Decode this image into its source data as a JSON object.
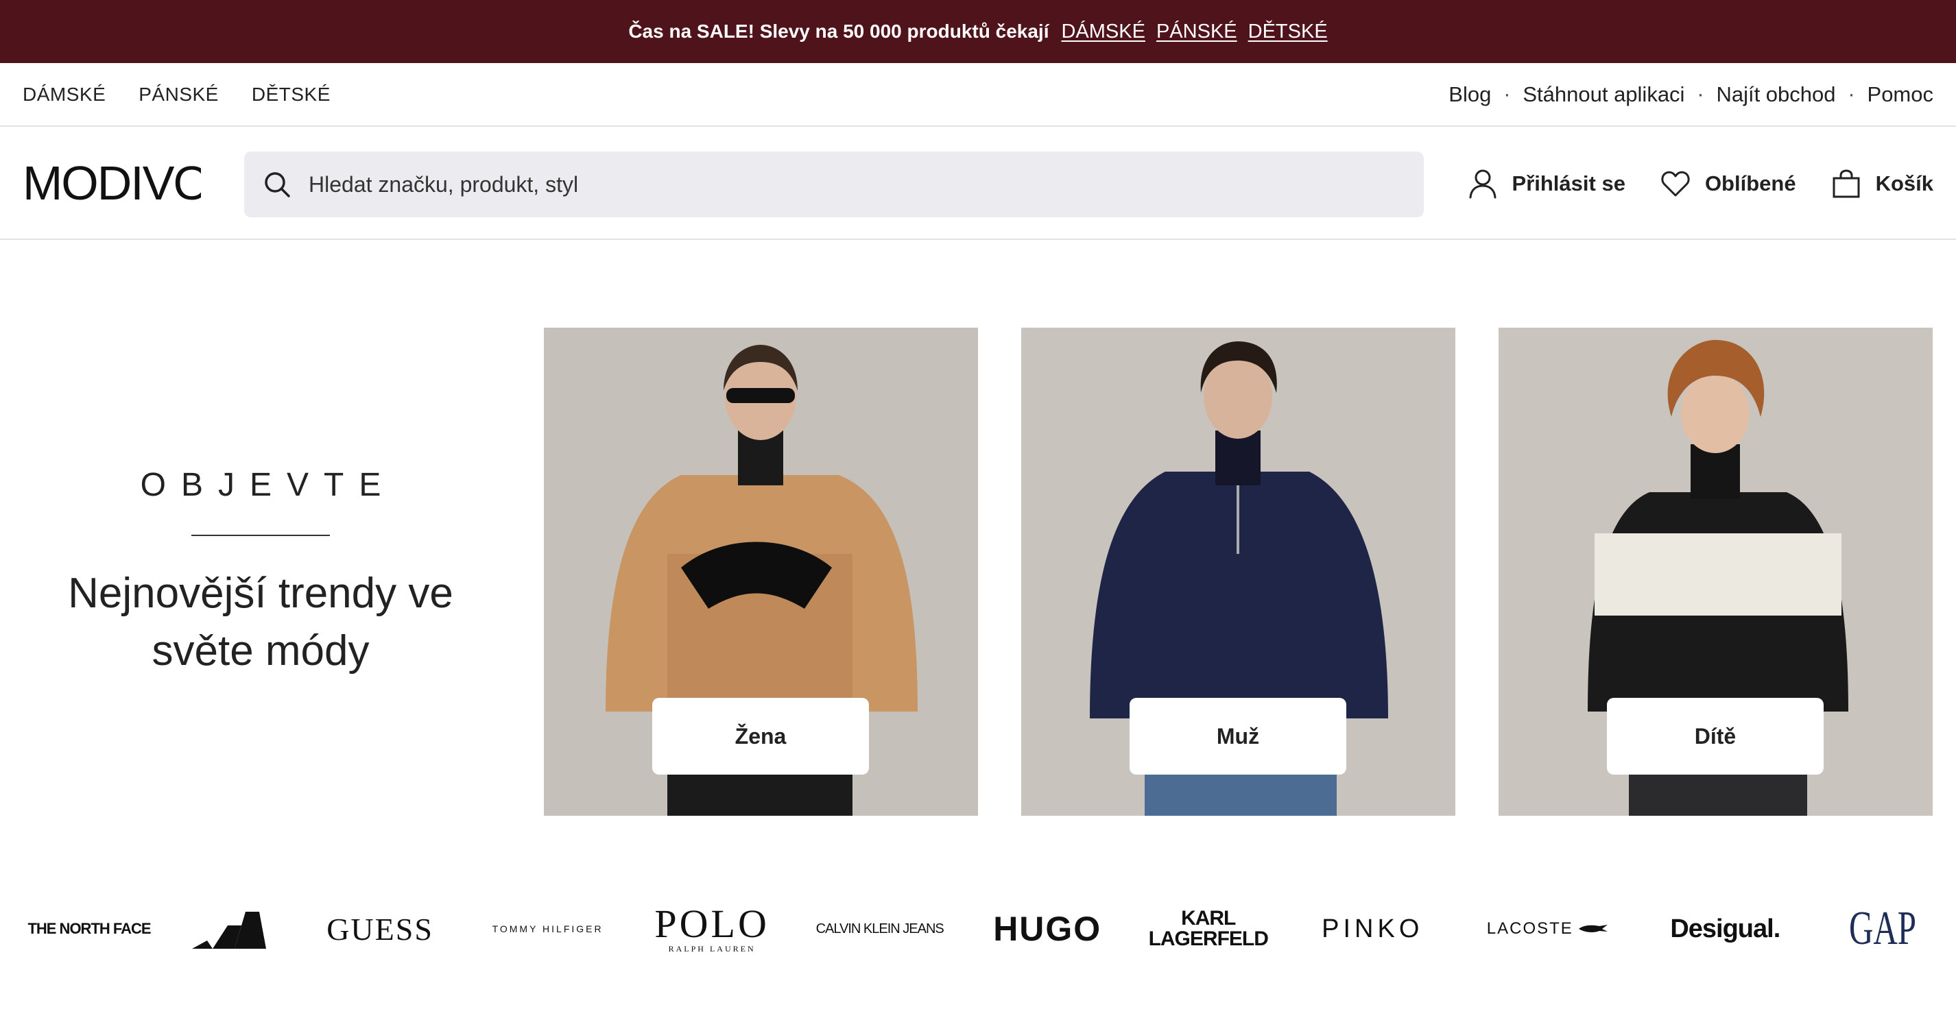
{
  "promo": {
    "message": "Čas na SALE! Slevy na 50 000 produktů čekají",
    "links": [
      "DÁMSKÉ",
      "PÁNSKÉ",
      "DĚTSKÉ"
    ]
  },
  "subnav": {
    "left": [
      "DÁMSKÉ",
      "PÁNSKÉ",
      "DĚTSKÉ"
    ],
    "right": [
      "Blog",
      "Stáhnout aplikaci",
      "Najít obchod",
      "Pomoc"
    ],
    "separator": "·"
  },
  "header": {
    "logo": "MODIVO",
    "search_placeholder": "Hledat značku, produkt, styl",
    "login": "Přihlásit se",
    "favorites": "Oblíbené",
    "cart": "Košík"
  },
  "hero": {
    "kicker": "OBJEVTE",
    "headline_line1": "Nejnovější trendy ve",
    "headline_line2": "světe módy",
    "cards": [
      {
        "label": "Žena",
        "shirt_color": "#c99563",
        "photo": "woman-photo"
      },
      {
        "label": "Muž",
        "shirt_color": "#1f2547",
        "photo": "man-photo"
      },
      {
        "label": "Dítě",
        "shirt_color": "#1a1a1a",
        "photo": "child-photo"
      }
    ]
  },
  "brands": [
    "THE NORTH FACE",
    "adidas",
    "GUESS",
    "TOMMY HILFIGER",
    "POLO",
    "RALPH LAUREN",
    "CALVIN KLEIN JEANS",
    "HUGO",
    "KARL LAGERFELD",
    "PINKO",
    "LACOSTE",
    "Desigual.",
    "GAP"
  ],
  "colors": {
    "promo_bg": "#4e131b",
    "search_bg": "#ecebef",
    "card_bg": "#c7c2bc",
    "gap_blue": "#1f2e57"
  }
}
